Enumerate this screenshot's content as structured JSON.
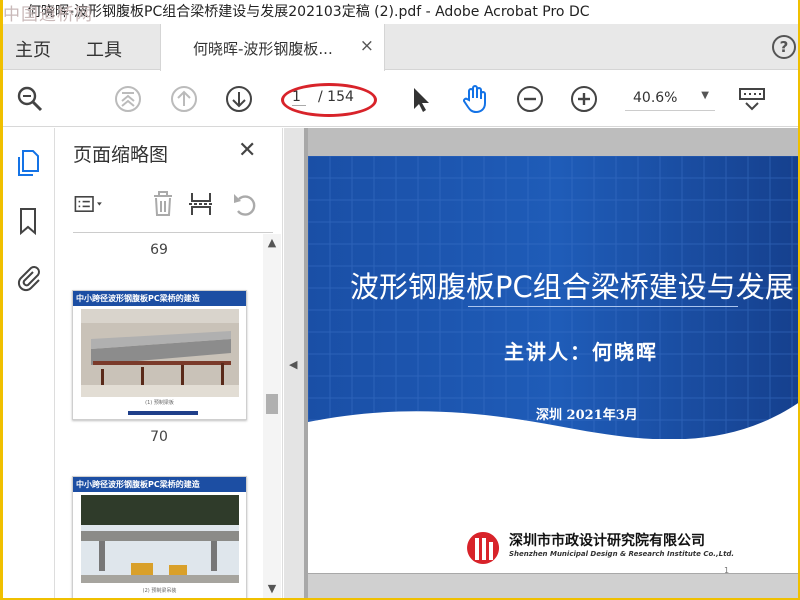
{
  "watermark": "中国道桥网",
  "window": {
    "title": "何晓晖-波形钢腹板PC组合梁桥建设与发展202103定稿 (2).pdf - Adobe Acrobat Pro DC"
  },
  "tabs": {
    "home": "主页",
    "tools": "工具",
    "doc": "何晓晖-波形钢腹板...",
    "close": "×",
    "help": "?"
  },
  "toolbar": {
    "page_current": "1",
    "page_total": "/ 154",
    "zoom": "40.6%"
  },
  "panel": {
    "title": "页面缩略图",
    "close": "✕",
    "thumbnails": [
      {
        "page": "69",
        "title": "中小跨径波形钢腹板PC梁桥的建造",
        "caption": "(1) 预制梁板"
      },
      {
        "page": "70",
        "title": "中小跨径波形钢腹板PC梁桥的建造",
        "caption": "(2) 预制梁吊装"
      }
    ]
  },
  "slide": {
    "title": "波形钢腹板PC组合梁桥建设与发展",
    "speaker": "主讲人：何晓晖",
    "date": "深圳 2021年3月",
    "org_cn": "深圳市市政设计研究院有限公司",
    "org_en": "Shenzhen Municipal Design & Research Institute Co.,Ltd.",
    "page_number": "1"
  },
  "colors": {
    "accent": "#1473e6",
    "banner": "#1c4ea3",
    "highlight": "#d8232a"
  }
}
